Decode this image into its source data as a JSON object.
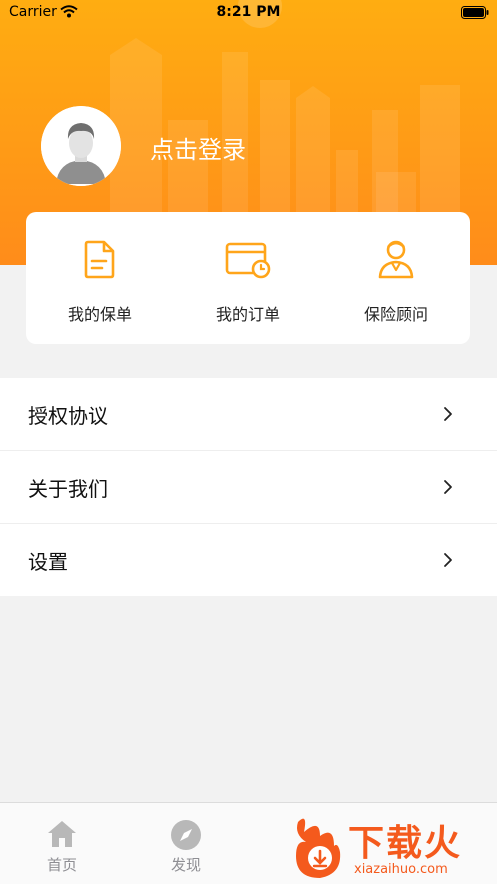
{
  "status_bar": {
    "carrier": "Carrier",
    "time": "8:21 PM"
  },
  "profile": {
    "login_text": "点击登录"
  },
  "quick_actions": [
    {
      "label": "我的保单",
      "icon": "policy-document-icon"
    },
    {
      "label": "我的订单",
      "icon": "order-card-icon"
    },
    {
      "label": "保险顾问",
      "icon": "advisor-person-icon"
    }
  ],
  "menu": [
    {
      "label": "授权协议"
    },
    {
      "label": "关于我们"
    },
    {
      "label": "设置"
    }
  ],
  "tabbar": [
    {
      "label": "首页",
      "icon": "home-icon"
    },
    {
      "label": "发现",
      "icon": "compass-icon"
    }
  ],
  "watermark": {
    "title": "下载火",
    "url": "xiazaihuo.com"
  },
  "colors": {
    "accent": "#ffa51a",
    "header_top": "#ffad11",
    "header_bottom": "#ff8c1a",
    "watermark": "#f45a1d"
  }
}
